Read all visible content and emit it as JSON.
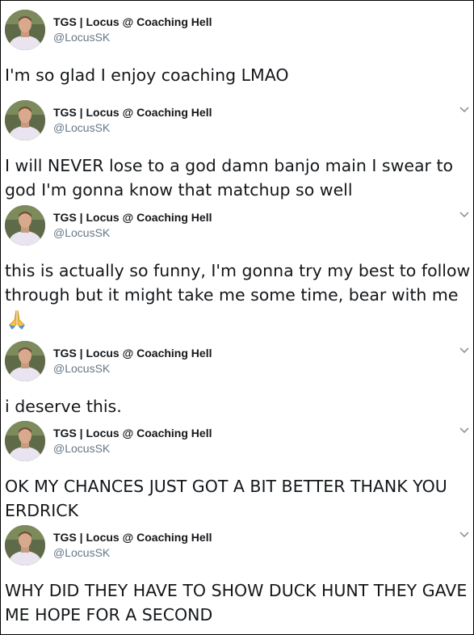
{
  "account": {
    "display_name": "TGS | Locus @ Coaching Hell",
    "handle": "@LocusSK"
  },
  "colors": {
    "name": "#14171a",
    "handle": "#657786",
    "text": "#14171a",
    "caret": "#8899a6"
  },
  "tweets": [
    {
      "text": "I'm so glad I enjoy coaching LMAO",
      "show_caret": false
    },
    {
      "text": "I will NEVER lose to a god damn banjo main I swear to god I'm gonna know that matchup so well",
      "show_caret": true
    },
    {
      "text": "this is actually so funny, I'm gonna try my best to follow through but it might take me some time, bear with me",
      "emoji": "folded-hands",
      "show_caret": true
    },
    {
      "text": "i deserve this.",
      "show_caret": true
    },
    {
      "text": "OK MY CHANCES JUST GOT A BIT BETTER THANK YOU ERDRICK",
      "show_caret": true
    },
    {
      "text": "WHY DID THEY HAVE TO SHOW DUCK HUNT THEY GAVE ME HOPE FOR A SECOND",
      "show_caret": true
    }
  ]
}
